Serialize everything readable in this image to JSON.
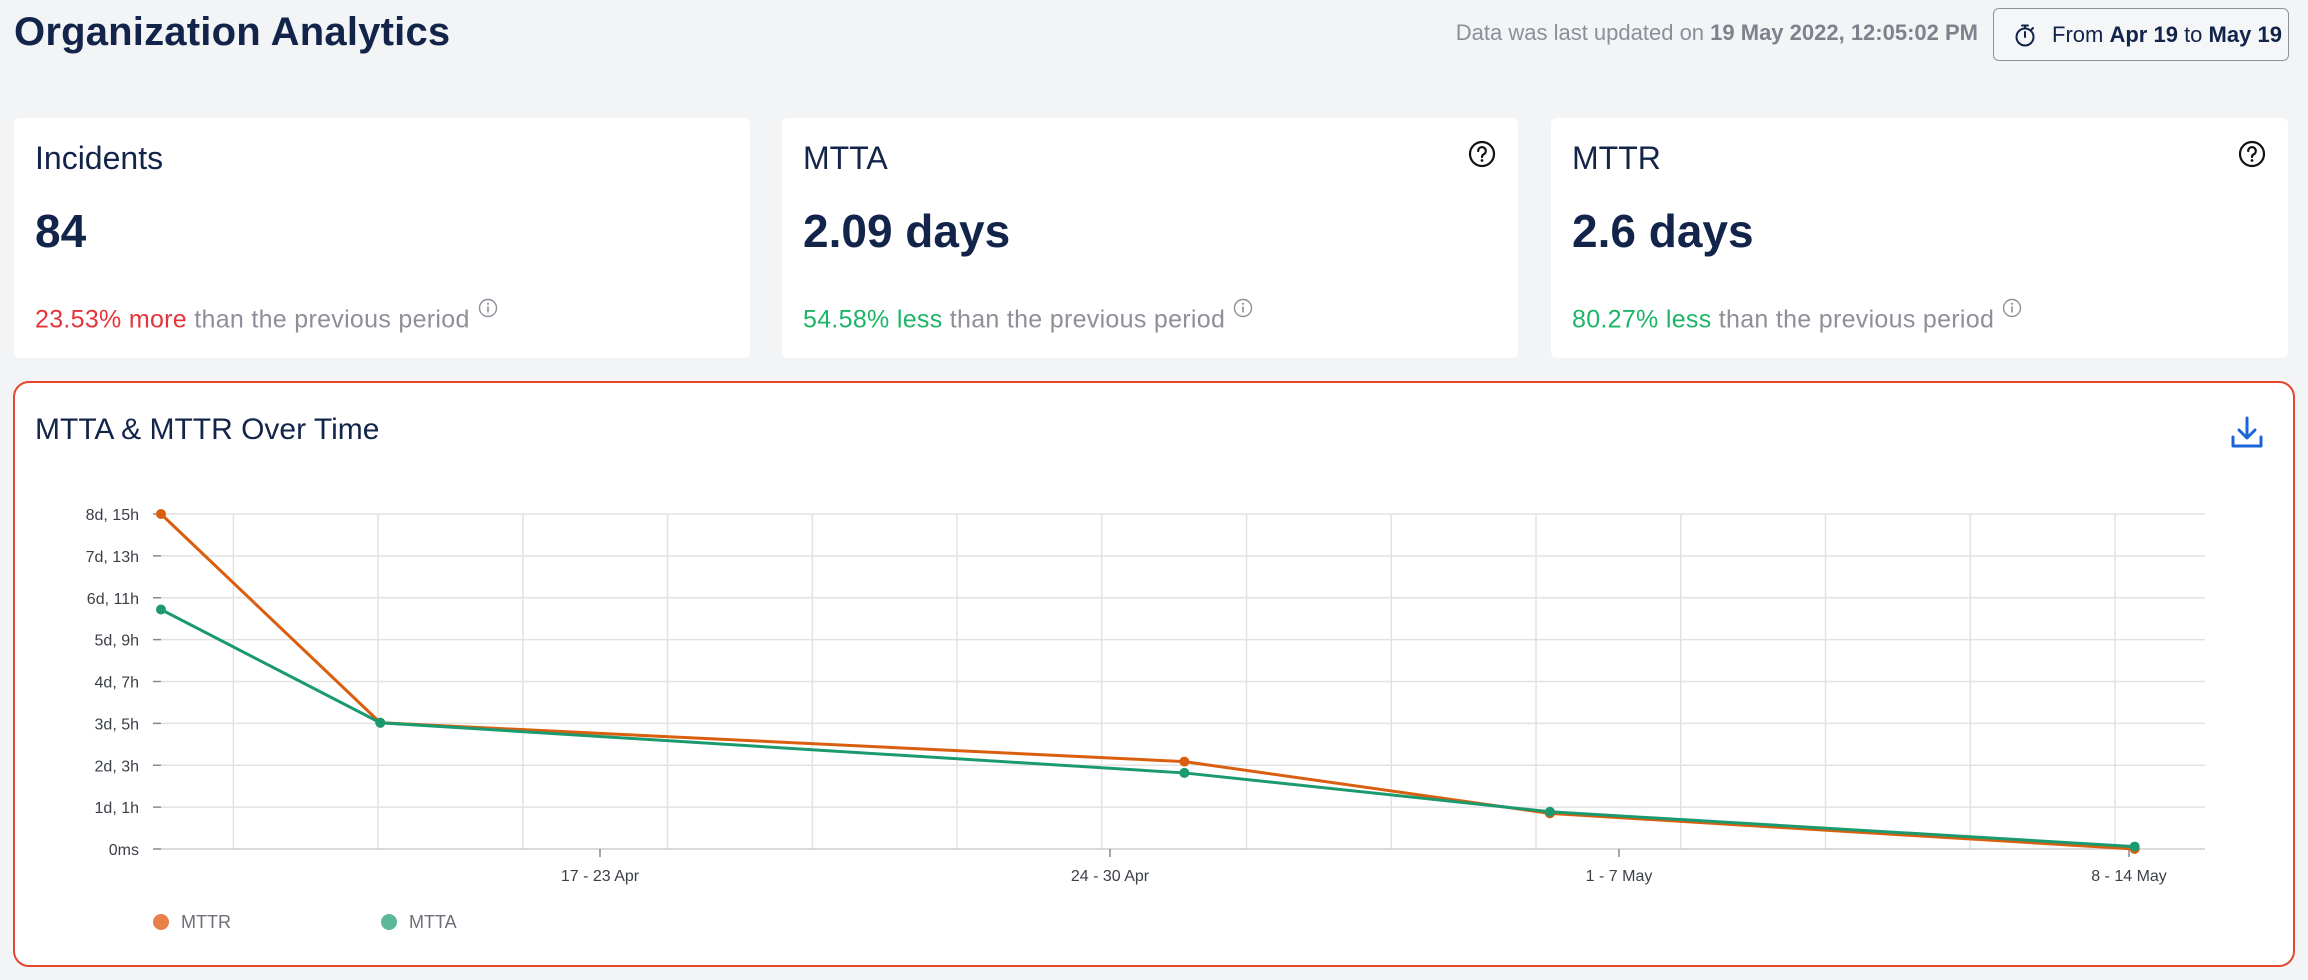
{
  "header": {
    "title": "Organization Analytics",
    "updated_prefix": "Data was last updated on ",
    "updated_value": "19 May 2022, 12:05:02 PM",
    "range": {
      "from_label": "From",
      "from_value": "Apr 19",
      "to_label": "to",
      "to_value": "May 19"
    }
  },
  "cards": [
    {
      "label": "Incidents",
      "value": "84",
      "delta": "23.53% more",
      "delta_direction": "up",
      "suffix": " than the previous period",
      "has_help": false
    },
    {
      "label": "MTTA",
      "value": "2.09 days",
      "delta": "54.58% less",
      "delta_direction": "down",
      "suffix": " than the previous period",
      "has_help": true
    },
    {
      "label": "MTTR",
      "value": "2.6 days",
      "delta": "80.27% less",
      "delta_direction": "down",
      "suffix": " than the previous period",
      "has_help": true
    }
  ],
  "colors": {
    "mttr": "#d95f0e",
    "mtta": "#1a9a6e",
    "delta_up": "#e5353b",
    "delta_down": "#1cb567",
    "panel_border": "#e6452e",
    "accent": "#1a66d9"
  },
  "icons": {
    "range": "stopwatch-icon",
    "help": "question-circle-icon",
    "info": "info-circle-icon",
    "download": "download-icon"
  },
  "chart_data": {
    "type": "line",
    "title": "MTTA & MTTR Over Time",
    "x_ticks": [
      "17 - 23 Apr",
      "24 - 30 Apr",
      "1 - 7 May",
      "8 - 14 May"
    ],
    "y_ticks": [
      "0ms",
      "1d, 1h",
      "2d, 3h",
      "3d, 5h",
      "4d, 7h",
      "5d, 9h",
      "6d, 11h",
      "7d, 13h",
      "8d, 15h"
    ],
    "y_unit": "hours",
    "ylim": [
      0,
      207
    ],
    "x": [
      "2022-04-19",
      "2022-04-22",
      "2022-05-03",
      "2022-05-08",
      "2022-05-16"
    ],
    "series": [
      {
        "name": "MTTR",
        "color": "#d95f0e",
        "values": [
          207,
          78,
          54,
          22,
          0
        ]
      },
      {
        "name": "MTTA",
        "color": "#1a9a6e",
        "values": [
          148,
          78,
          47,
          23,
          1.5
        ]
      }
    ],
    "grid": true,
    "legend": "bottom-left"
  }
}
